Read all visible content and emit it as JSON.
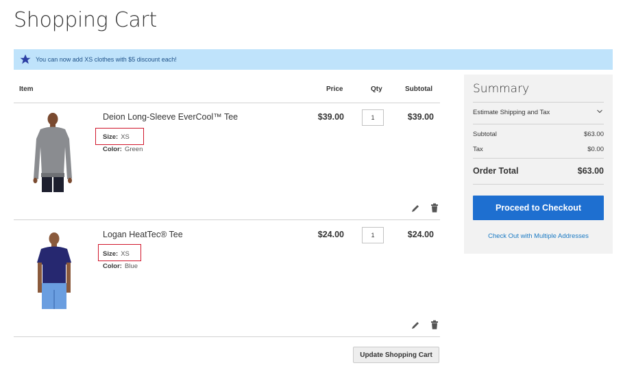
{
  "page": {
    "title": "Shopping Cart"
  },
  "notice": {
    "icon": "star-icon",
    "message": "You can now add XS clothes with $5 discount each!",
    "bg_color": "#bfe3fb",
    "icon_color": "#2c3fa4"
  },
  "cart": {
    "headers": {
      "item": "Item",
      "price": "Price",
      "qty": "Qty",
      "subtotal": "Subtotal"
    },
    "items": [
      {
        "name": "Deion Long-Sleeve EverCool™ Tee",
        "size_label": "Size:",
        "size": "XS",
        "color_label": "Color:",
        "color": "Green",
        "price": "$39.00",
        "qty": "1",
        "subtotal": "$39.00"
      },
      {
        "name": "Logan HeatTec® Tee",
        "size_label": "Size:",
        "size": "XS",
        "color_label": "Color:",
        "color": "Blue",
        "price": "$24.00",
        "qty": "1",
        "subtotal": "$24.00"
      }
    ],
    "update_label": "Update Shopping Cart"
  },
  "summary": {
    "title": "Summary",
    "estimate_label": "Estimate Shipping and Tax",
    "subtotal_label": "Subtotal",
    "subtotal": "$63.00",
    "tax_label": "Tax",
    "tax": "$0.00",
    "total_label": "Order Total",
    "total": "$63.00",
    "checkout_label": "Proceed to Checkout",
    "multi_label": "Check Out with Multiple Addresses",
    "accent_color": "#1e6fd0"
  }
}
